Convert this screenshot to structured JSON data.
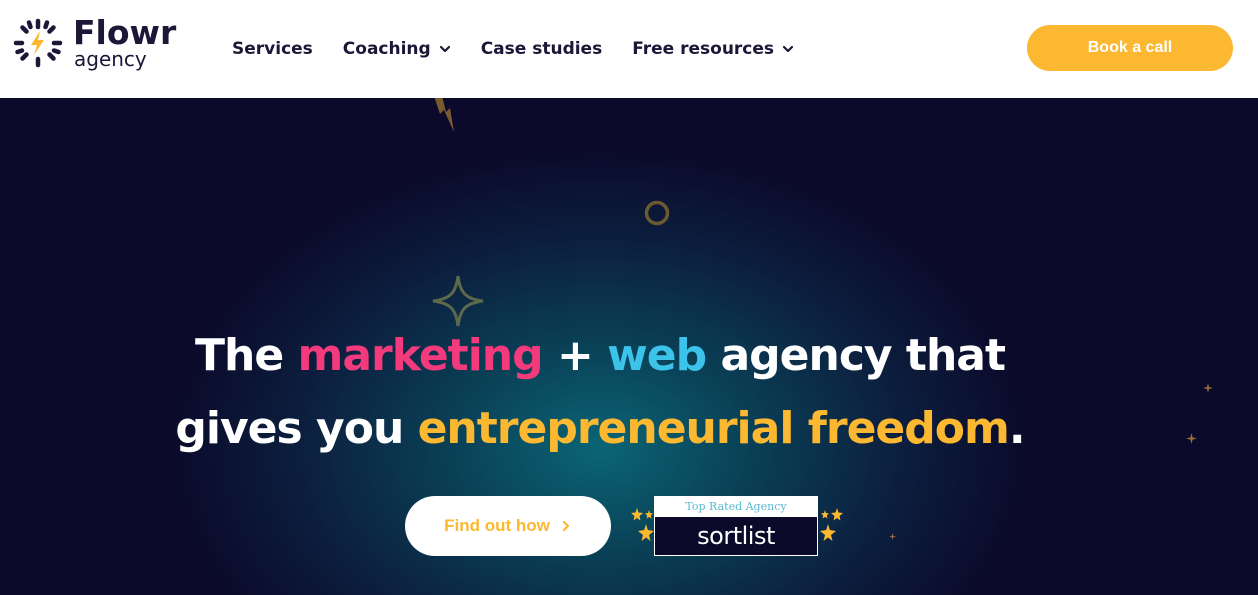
{
  "header": {
    "logo": {
      "name": "Flowr",
      "sub": "agency"
    },
    "nav": [
      {
        "label": "Services",
        "dropdown": false
      },
      {
        "label": "Coaching",
        "dropdown": true
      },
      {
        "label": "Case studies",
        "dropdown": false
      },
      {
        "label": "Free resources",
        "dropdown": true
      }
    ],
    "cta_label": "Book a call"
  },
  "hero": {
    "line1": {
      "the": "The",
      "marketing": "marketing",
      "plus": "+",
      "web": "web",
      "rest": "agency that"
    },
    "line2": {
      "start": "gives you",
      "highlight": "entrepreneurial freedom",
      "end": "."
    },
    "cta_label": "Find out how",
    "badge": {
      "top": "Top Rated Agency",
      "brand": "sortlist"
    }
  },
  "colors": {
    "accent": "#fbb830",
    "pink": "#f23a7d",
    "blue": "#3bc3ea",
    "navy": "#1b1737",
    "hero_bg": "#0b0a2a"
  },
  "icons": [
    "sunburst-logo-icon",
    "lightning-icon",
    "chevron-down-icon",
    "chevron-right-icon",
    "sparkle-icon",
    "circle-icon",
    "star-icon"
  ]
}
